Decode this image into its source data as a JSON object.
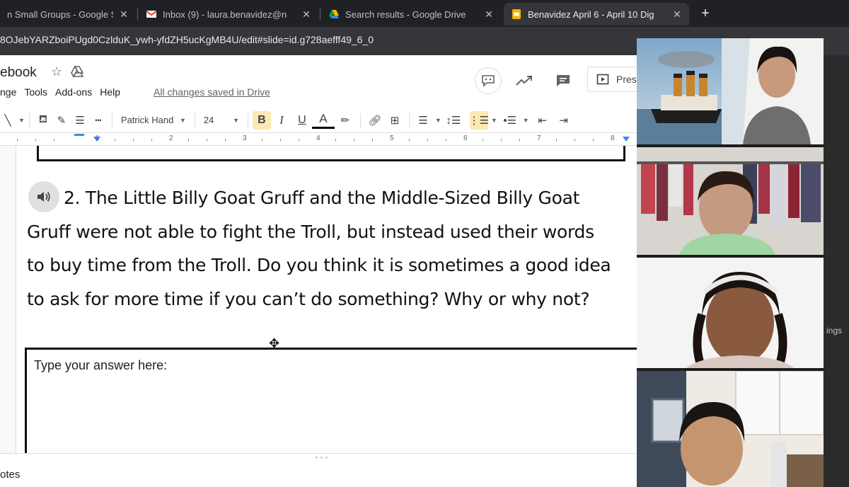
{
  "browser": {
    "tabs": [
      {
        "title": "n Small Groups - Google S",
        "icon": "google-icon",
        "active": false
      },
      {
        "title": "Inbox (9) - laura.benavidez@n",
        "icon": "gmail-icon",
        "active": false
      },
      {
        "title": "Search results - Google Drive",
        "icon": "drive-icon",
        "active": false
      },
      {
        "title": "Benavidez April 6 - April 10 Dig",
        "icon": "slides-icon",
        "active": true
      }
    ],
    "new_tab_label": "+",
    "url": "8OJebYARZboiPUgd0CzlduK_ywh-yfdZH5ucKgMB4U/edit#slide=id.g728aefff49_6_0"
  },
  "doc": {
    "title": "ebook",
    "saved_status": "All changes saved in Drive",
    "menu": [
      "nge",
      "Tools",
      "Add-ons",
      "Help"
    ],
    "present_label": "Pres"
  },
  "toolbar": {
    "font": "Patrick Hand",
    "font_size": "24",
    "bold": "B",
    "italic": "I",
    "underline": "U",
    "text_color": "A"
  },
  "ruler": {
    "labels": [
      "1",
      "2",
      "3",
      "4",
      "5",
      "6",
      "7",
      "8"
    ]
  },
  "slide": {
    "question": "2. The Little Billy Goat Gruff and the Middle-Sized Billy Goat Gruff were not able to fight the Troll, but instead used their words to buy time from the Troll.  Do you think it is sometimes a good idea to ask for more time if you can’t do something? Why or why not?",
    "answer_placeholder": "Type your answer here:"
  },
  "notes": {
    "label": "otes"
  },
  "side_panel": {
    "label": "ings"
  },
  "colors": {
    "tab_bg": "#202124",
    "active_tab": "#35363a",
    "highlight": "#fce8b2",
    "notes_border": "#dadce0"
  }
}
